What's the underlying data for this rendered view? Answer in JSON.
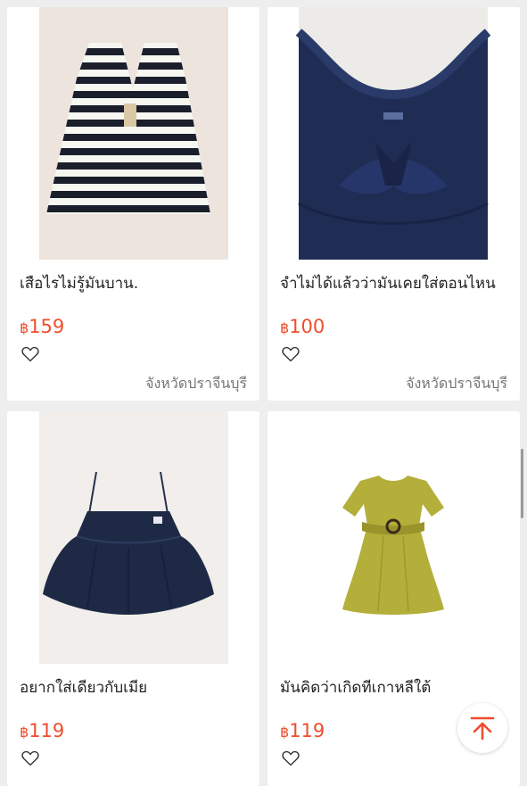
{
  "products": [
    {
      "title": "เสือไรไม่รู้มันบาน.",
      "currency": "฿",
      "price": "159",
      "location": "จังหวัดปราจีนบุรี",
      "image": "striped-top-photo"
    },
    {
      "title": "จำไม่ได้แล้วว่ามันเคยใส่ตอนไหน",
      "currency": "฿",
      "price": "100",
      "location": "จังหวัดปราจีนบุรี",
      "image": "navy-ruffle-top-photo"
    },
    {
      "title": "อยากใส่เดียวกับเมีย",
      "currency": "฿",
      "price": "119",
      "location": "",
      "image": "navy-camisole-photo"
    },
    {
      "title": "มันคิดว่าเกิดทีเกาหลีใต้",
      "currency": "฿",
      "price": "119",
      "location": "",
      "image": "olive-dress-photo"
    }
  ],
  "icons": {
    "like": "heart-outline-icon",
    "to_top": "arrow-up-bar-icon"
  },
  "colors": {
    "price": "#ee4d2d",
    "background": "#eeeeee",
    "card": "#ffffff"
  }
}
